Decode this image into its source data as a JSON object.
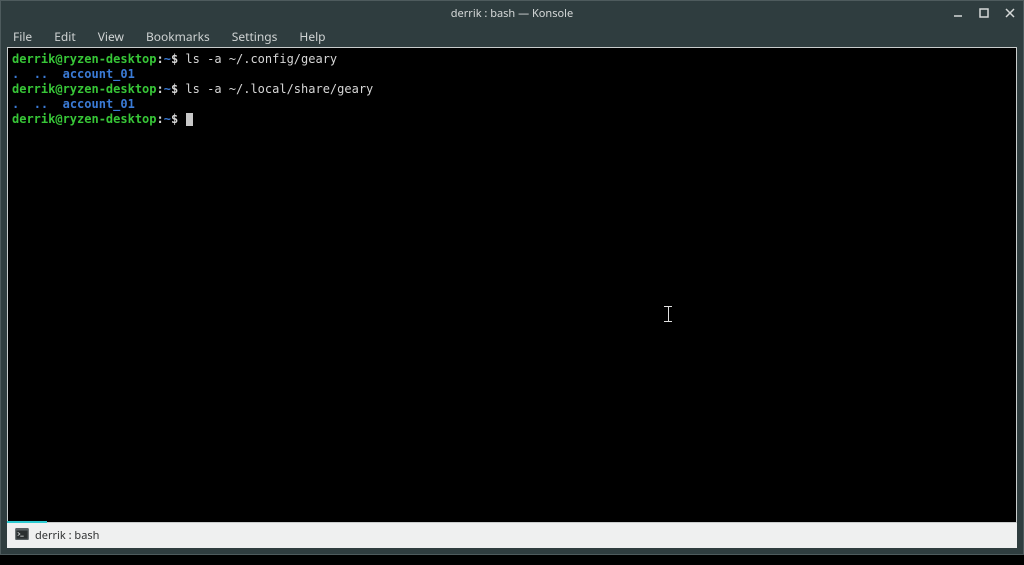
{
  "window": {
    "title": "derrik : bash — Konsole"
  },
  "menubar": {
    "file": "File",
    "edit": "Edit",
    "view": "View",
    "bookmarks": "Bookmarks",
    "settings": "Settings",
    "help": "Help"
  },
  "terminal": {
    "prompt": {
      "userhost": "derrik@ryzen-desktop",
      "colon": ":",
      "path": "~",
      "suffix": "$ "
    },
    "lines": [
      {
        "cmd": "ls -a ~/.config/geary"
      },
      {
        "ls": {
          "dot": ".",
          "dotdot": "..",
          "folder": "account_01"
        }
      },
      {
        "cmd": "ls -a ~/.local/share/geary"
      },
      {
        "ls": {
          "dot": ".",
          "dotdot": "..",
          "folder": "account_01"
        }
      }
    ]
  },
  "tab": {
    "label": "derrik : bash"
  }
}
